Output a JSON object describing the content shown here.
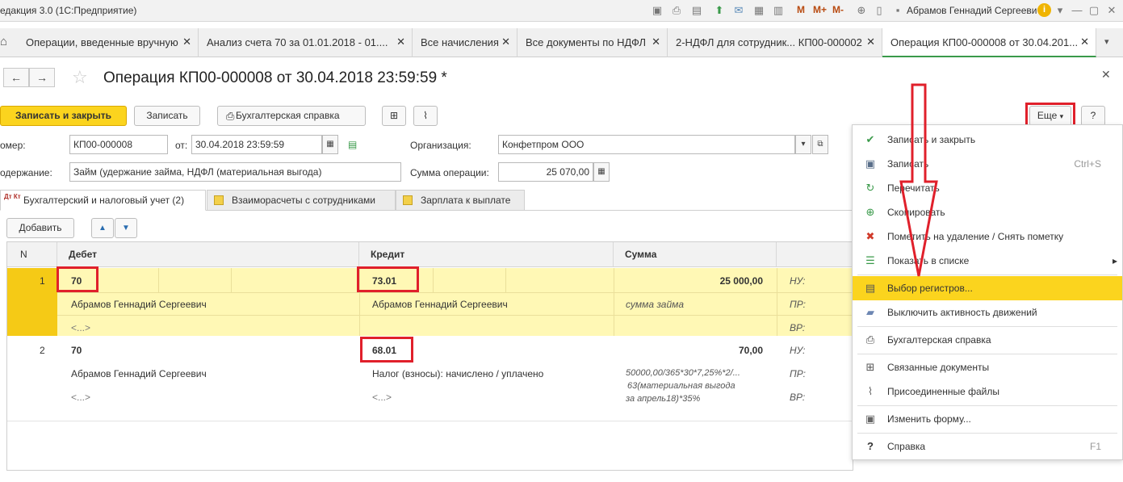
{
  "window": {
    "app_title": "едакция 3.0  (1С:Предприятие)",
    "toolbar_m": [
      "M",
      "M+",
      "M-"
    ],
    "user": "Абрамов Геннадий Сергеевич",
    "info_icon": "info-icon"
  },
  "tabs": [
    {
      "label": "Операции, введенные вручную"
    },
    {
      "label": "Анализ счета 70 за 01.01.2018 - 01...."
    },
    {
      "label": "Все начисления"
    },
    {
      "label": "Все документы по НДФЛ"
    },
    {
      "label": "2-НДФЛ для сотрудник... КП00-000002"
    },
    {
      "label": "Операция КП00-000008 от 30.04.201..."
    }
  ],
  "form": {
    "title": "Операция КП00-000008 от 30.04.2018 23:59:59 *",
    "toolbar": {
      "save_close": "Записать и закрыть",
      "save": "Записать",
      "report": "Бухгалтерская справка",
      "more": "Еще",
      "help": "?"
    },
    "fields": {
      "number_label": "омер:",
      "number_value": "КП00-000008",
      "date_label": "от:",
      "date_value": "30.04.2018 23:59:59",
      "org_label": "Организация:",
      "org_value": "Конфетпром ООО",
      "content_label": "одержание:",
      "content_value": "Займ (удержание займа, НДФЛ (материальная выгода)",
      "sum_label": "Сумма операции:",
      "sum_value": "25 070,00"
    },
    "subtabs": [
      {
        "label": "Бухгалтерский и налоговый учет (2)",
        "icon_text": "Дт Кт"
      },
      {
        "label": "Взаиморасчеты с сотрудниками"
      },
      {
        "label": "Зарплата к выплате"
      }
    ],
    "grid_toolbar": {
      "add": "Добавить",
      "up": "▲",
      "down": "▼"
    },
    "columns": [
      "N",
      "Дебет",
      "Кредит",
      "Сумма"
    ],
    "rows": [
      {
        "n": "1",
        "debit": "70",
        "credit": "73.01",
        "sum": "25 000,00",
        "nu": "НУ:",
        "debit_sub": "Абрамов Геннадий Сергеевич",
        "credit_sub": "Абрамов Геннадий Сергеевич",
        "sum_sub": "сумма займа",
        "pr": "ПР:",
        "debit_sub2": "<...>",
        "vr": "ВР:"
      },
      {
        "n": "2",
        "debit": "70",
        "credit": "68.01",
        "sum": "70,00",
        "nu": "НУ:",
        "debit_sub": "Абрамов Геннадий Сергеевич",
        "credit_sub": "Налог (взносы): начислено / уплачено",
        "sum_sub": "50000,00/365*30*7,25%*2/...",
        "pr": "ПР:",
        "debit_sub2": "<...>",
        "credit_sub2": "<...>",
        "sum_sub2": "63(материальная выгода",
        "sum_sub3": "за апрель18)*35%",
        "vr": "ВР:"
      }
    ]
  },
  "menu": [
    {
      "label": "Записать и закрыть",
      "icon": "check-icon"
    },
    {
      "label": "Записать",
      "icon": "save-icon",
      "shortcut": "Ctrl+S"
    },
    {
      "label": "Перечитать",
      "icon": "refresh-icon"
    },
    {
      "label": "Скопировать",
      "icon": "copy-icon"
    },
    {
      "label": "Пометить на удаление / Снять пометку",
      "icon": "delete-mark-icon"
    },
    {
      "label": "Показать в списке",
      "icon": "list-icon",
      "submenu": "▸"
    },
    {
      "label": "Выбор регистров...",
      "icon": "registers-icon"
    },
    {
      "label": "Выключить активность движений",
      "icon": "deactivate-icon"
    },
    {
      "label": "Бухгалтерская справка",
      "icon": "print-icon"
    },
    {
      "label": "Связанные документы",
      "icon": "linked-docs-icon"
    },
    {
      "label": "Присоединенные файлы",
      "icon": "paperclip-icon"
    },
    {
      "label": "Изменить форму...",
      "icon": "form-settings-icon"
    },
    {
      "label": "Справка",
      "icon": "help-icon",
      "shortcut": "F1"
    }
  ],
  "colors": {
    "accent_yellow": "#fbd41e",
    "highlight_row": "#fff8b5",
    "red_annotation": "#e0202b",
    "active_tab_green": "#3a9a4a"
  }
}
